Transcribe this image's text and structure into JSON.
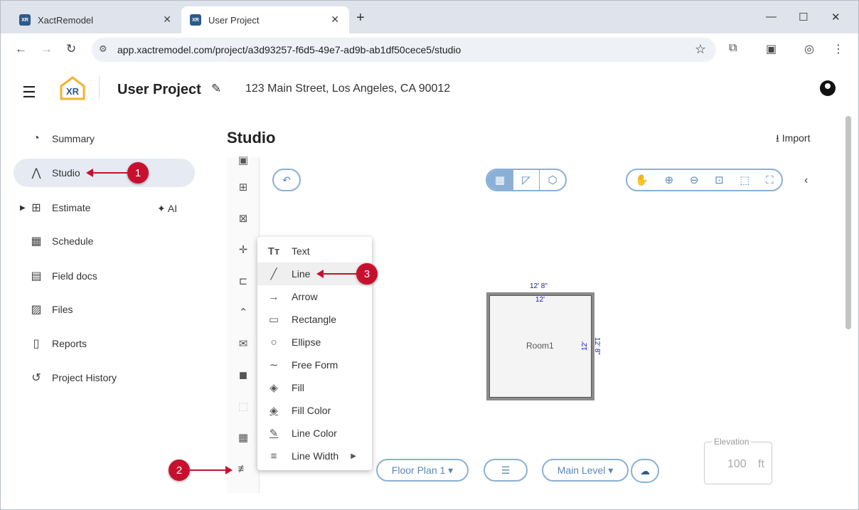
{
  "browser": {
    "tabs": [
      {
        "label": "XactRemodel",
        "favicon": "XR"
      },
      {
        "label": "User Project",
        "favicon": "XR"
      }
    ],
    "url": "app.xactremodel.com/project/a3d93257-f6d5-49e7-ad9b-ab1df50cece5/studio"
  },
  "header": {
    "logo_text": "XR",
    "project_title": "User Project",
    "address": "123 Main Street, Los Angeles, CA 90012"
  },
  "sidebar": {
    "items": [
      {
        "label": "Summary",
        "icon": "gauge-icon"
      },
      {
        "label": "Studio",
        "icon": "compass-icon"
      },
      {
        "label": "Estimate",
        "icon": "calculator-icon"
      },
      {
        "label": "Schedule",
        "icon": "calendar-icon"
      },
      {
        "label": "Field docs",
        "icon": "clipboard-icon"
      },
      {
        "label": "Files",
        "icon": "images-icon"
      },
      {
        "label": "Reports",
        "icon": "document-icon"
      },
      {
        "label": "Project History",
        "icon": "history-icon"
      }
    ],
    "ai_label": "AI"
  },
  "main": {
    "title": "Studio",
    "import_label": "Import"
  },
  "canvas": {
    "room_label": "Room1",
    "dim_outer_top": "12' 8\"",
    "dim_inner_top": "12'",
    "dim_inner_right": "12'",
    "dim_outer_right": "12' 8\""
  },
  "bottom": {
    "floor_plan": "Floor Plan 1",
    "level": "Main Level",
    "elevation_label": "Elevation",
    "elevation_value": "100",
    "elevation_unit": "ft"
  },
  "menu": {
    "items": [
      {
        "label": "Text",
        "icon": "text-icon"
      },
      {
        "label": "Line",
        "icon": "line-icon"
      },
      {
        "label": "Arrow",
        "icon": "arrow-icon"
      },
      {
        "label": "Rectangle",
        "icon": "rectangle-icon"
      },
      {
        "label": "Ellipse",
        "icon": "ellipse-icon"
      },
      {
        "label": "Free Form",
        "icon": "freeform-icon"
      },
      {
        "label": "Fill",
        "icon": "fill-icon"
      },
      {
        "label": "Fill Color",
        "icon": "fill-color-icon"
      },
      {
        "label": "Line Color",
        "icon": "line-color-icon"
      },
      {
        "label": "Line Width",
        "icon": "line-width-icon"
      }
    ]
  },
  "callouts": [
    "1",
    "2",
    "3"
  ],
  "colors": {
    "accent": "#8ab0d6",
    "callout": "#c8102e",
    "dimension": "#1515c8"
  }
}
